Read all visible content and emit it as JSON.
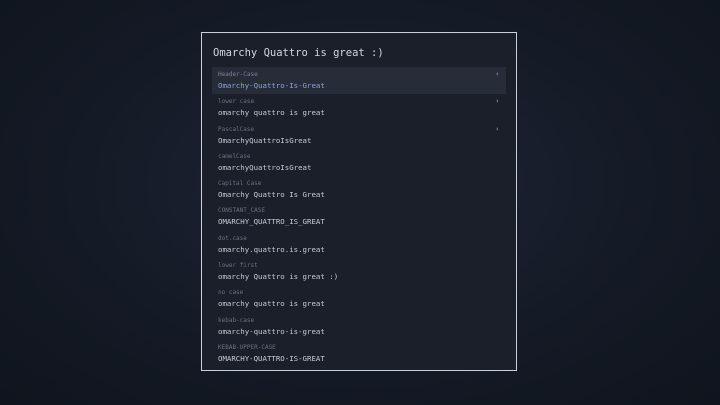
{
  "search": {
    "query": "Omarchy Quattro is great :)"
  },
  "results": [
    {
      "label": "Header-Case",
      "value": "Omarchy-Quattro-Is-Great",
      "selected": true,
      "pin": "⬍"
    },
    {
      "label": "lower case",
      "value": "omarchy quattro is great",
      "pin": "⬍"
    },
    {
      "label": "PascalCase",
      "value": "OmarchyQuattroIsGreat",
      "pin": "⬍"
    },
    {
      "label": "camelCase",
      "value": "omarchyQuattroIsGreat"
    },
    {
      "label": "Capital Case",
      "value": "Omarchy Quattro Is Great"
    },
    {
      "label": "CONSTANT_CASE",
      "value": "OMARCHY_QUATTRO_IS_GREAT"
    },
    {
      "label": "dot.case",
      "value": "omarchy.quattro.is.great"
    },
    {
      "label": "lower first",
      "value": "omarchy Quattro is great :)"
    },
    {
      "label": "no case",
      "value": "omarchy quattro is great"
    },
    {
      "label": "kebab-case",
      "value": "omarchy-quattro-is-great"
    },
    {
      "label": "KEBAB-UPPER-CASE",
      "value": "OMARCHY-QUATTRO-IS-GREAT"
    }
  ],
  "colors": {
    "accent": "#8aa2de",
    "border": "#c9cfdc",
    "panel": "#1a1f29",
    "selected_bg": "#262c38"
  }
}
